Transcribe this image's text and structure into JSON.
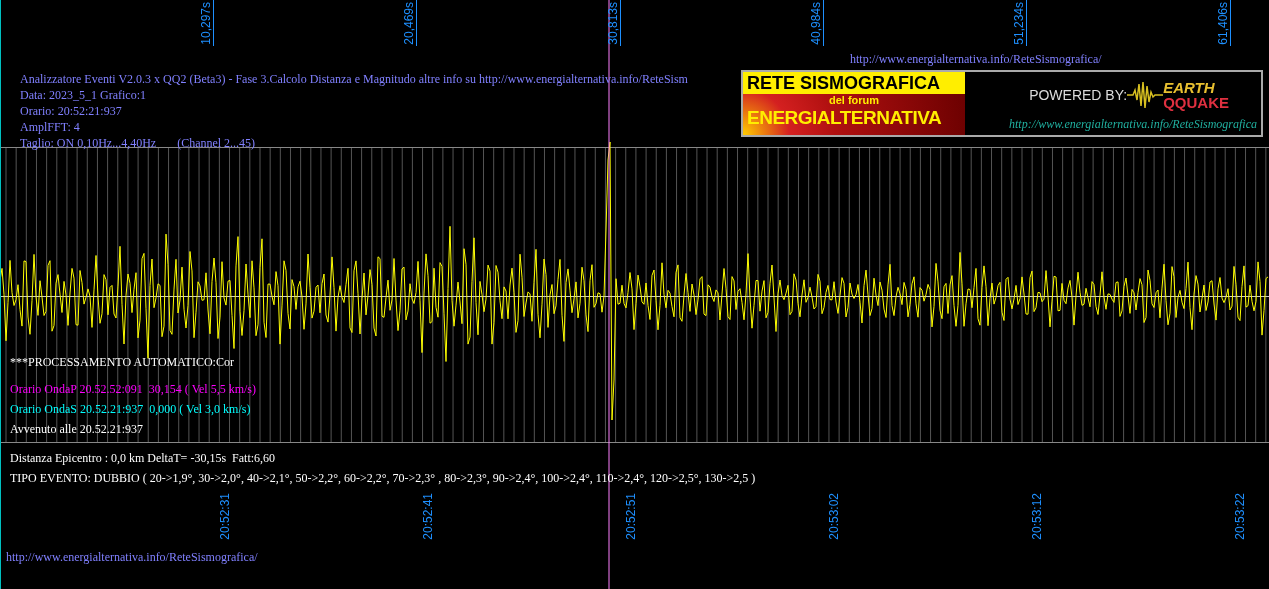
{
  "top_axis": {
    "ticks": [
      "10,297s",
      "20,469s",
      "30,813s",
      "40,984s",
      "51,234s",
      "61,406s"
    ]
  },
  "top_url": "http://www.energialternativa.info/ReteSismografica/",
  "header": {
    "lines": [
      "Analizzatore Eventi V2.0.3 x QQ2 (Beta3) - Fase 3.Calcolo Distanza e Magnitudo altre info su http://www.energialternativa.info/ReteSism",
      "Data: 2023_5_1 Grafico:1",
      "Orario: 20:52:21:937",
      "AmplFFT: 4",
      "Taglio: ON 0,10Hz...4,40Hz       (Channel 2...45)"
    ]
  },
  "banner": {
    "title": "RETE SISMOGRAFICA",
    "subtitle": "del forum",
    "name": "ENERGIALTERNATIVA",
    "powered": "POWERED BY:",
    "logo_top": "EARTH",
    "logo_bottom": "QQUAKE",
    "url": "http://www.energialternativa.info/ReteSismografica"
  },
  "processing": {
    "title": "***PROCESSAMENTO AUTOMATICO:Cor",
    "lines": [
      {
        "text": "Orario OndaP 20.52.52:091  30,154 ( Vel 5,5 km/s)",
        "color": "#ff00ff"
      },
      {
        "text": "Orario OndaS 20.52.21:937  0,000 ( Vel 3,0 km/s)",
        "color": "#00ffff"
      },
      {
        "text": "Avvenuto alle 20.52.21:937",
        "color": "#ffffff"
      }
    ]
  },
  "results": [
    "Distanza Epicentro : 0,0 km DeltaT= -30,15s  Fatt:6,60",
    "TIPO EVENTO: DUBBIO ( 20->1,9°, 30->2,0°, 40->2,1°, 50->2,2°, 60->2,2°, 70->2,3° , 80->2,3°, 90->2,4°, 100->2,4°, 110->2,4°, 120->2,5°, 130->2,5 )"
  ],
  "bottom_axis": {
    "ticks": [
      "20:52:31",
      "20:52:41",
      "20:52:51",
      "20:53:02",
      "20:53:12",
      "20:53:22"
    ]
  },
  "footer_url": "http://www.energialternativa.info/ReteSismografica/"
}
